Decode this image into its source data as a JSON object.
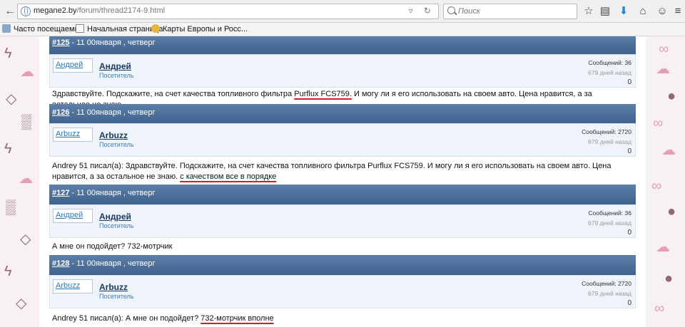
{
  "browser": {
    "url_host": "megane2.by",
    "url_path": "/forum/thread2174-9.html",
    "search_placeholder": "Поиск",
    "bookmarks": [
      {
        "label": "Часто посещаемые"
      },
      {
        "label": "Начальная страница"
      },
      {
        "label": "Карты Европы и Росс..."
      }
    ]
  },
  "posts": [
    {
      "num": "#125",
      "date": " - 11 00января , четверг",
      "avatar": "Андрей",
      "user": "Андрей",
      "role": "Посетитель",
      "posts_count": "Сообщений: 36",
      "ago": "679 дней назад",
      "rep": "0",
      "body": [
        {
          "t": "Здравствуйте. Подскажите, на счет качества топливного фильтра "
        },
        {
          "t": "Purflux FCS759.",
          "u": true
        },
        {
          "t": " И могу ли я его использовать на своем авто. Цена нравится, а за остальное не знаю."
        }
      ]
    },
    {
      "num": "#126",
      "date": " - 11 00января , четверг",
      "avatar": "Arbuzz",
      "user": "Arbuzz",
      "role": "Посетитель",
      "posts_count": "Сообщений: 2720",
      "ago": "679 дней назад",
      "rep": "0",
      "body": [
        {
          "t": "Andrey 51 писал(а): Здравствуйте. Подскажите, на счет качества топливного фильтра Purflux FCS759. И могу ли я его использовать на своем авто. Цена нравится, а за остальное не знаю. "
        },
        {
          "t": "с качеством все в порядке",
          "u": true
        }
      ]
    },
    {
      "num": "#127",
      "date": " - 11 00января , четверг",
      "avatar": "Андрей",
      "user": "Андрей",
      "role": "Посетитель",
      "posts_count": "Сообщений: 36",
      "ago": "679 дней назад",
      "rep": "0",
      "body": [
        {
          "t": "А мне он подойдет? 732-мотрчик"
        }
      ]
    },
    {
      "num": "#128",
      "date": " - 11 00января , четверг",
      "avatar": "Arbuzz",
      "user": "Arbuzz",
      "role": "Посетитель",
      "posts_count": "Сообщений: 2720",
      "ago": "679 дней назад",
      "rep": "0",
      "body": [
        {
          "t": "Andrey 51 писал(а): А мне он подойдет? "
        },
        {
          "t": "732-мотрчик вполне",
          "u": true
        }
      ]
    }
  ]
}
